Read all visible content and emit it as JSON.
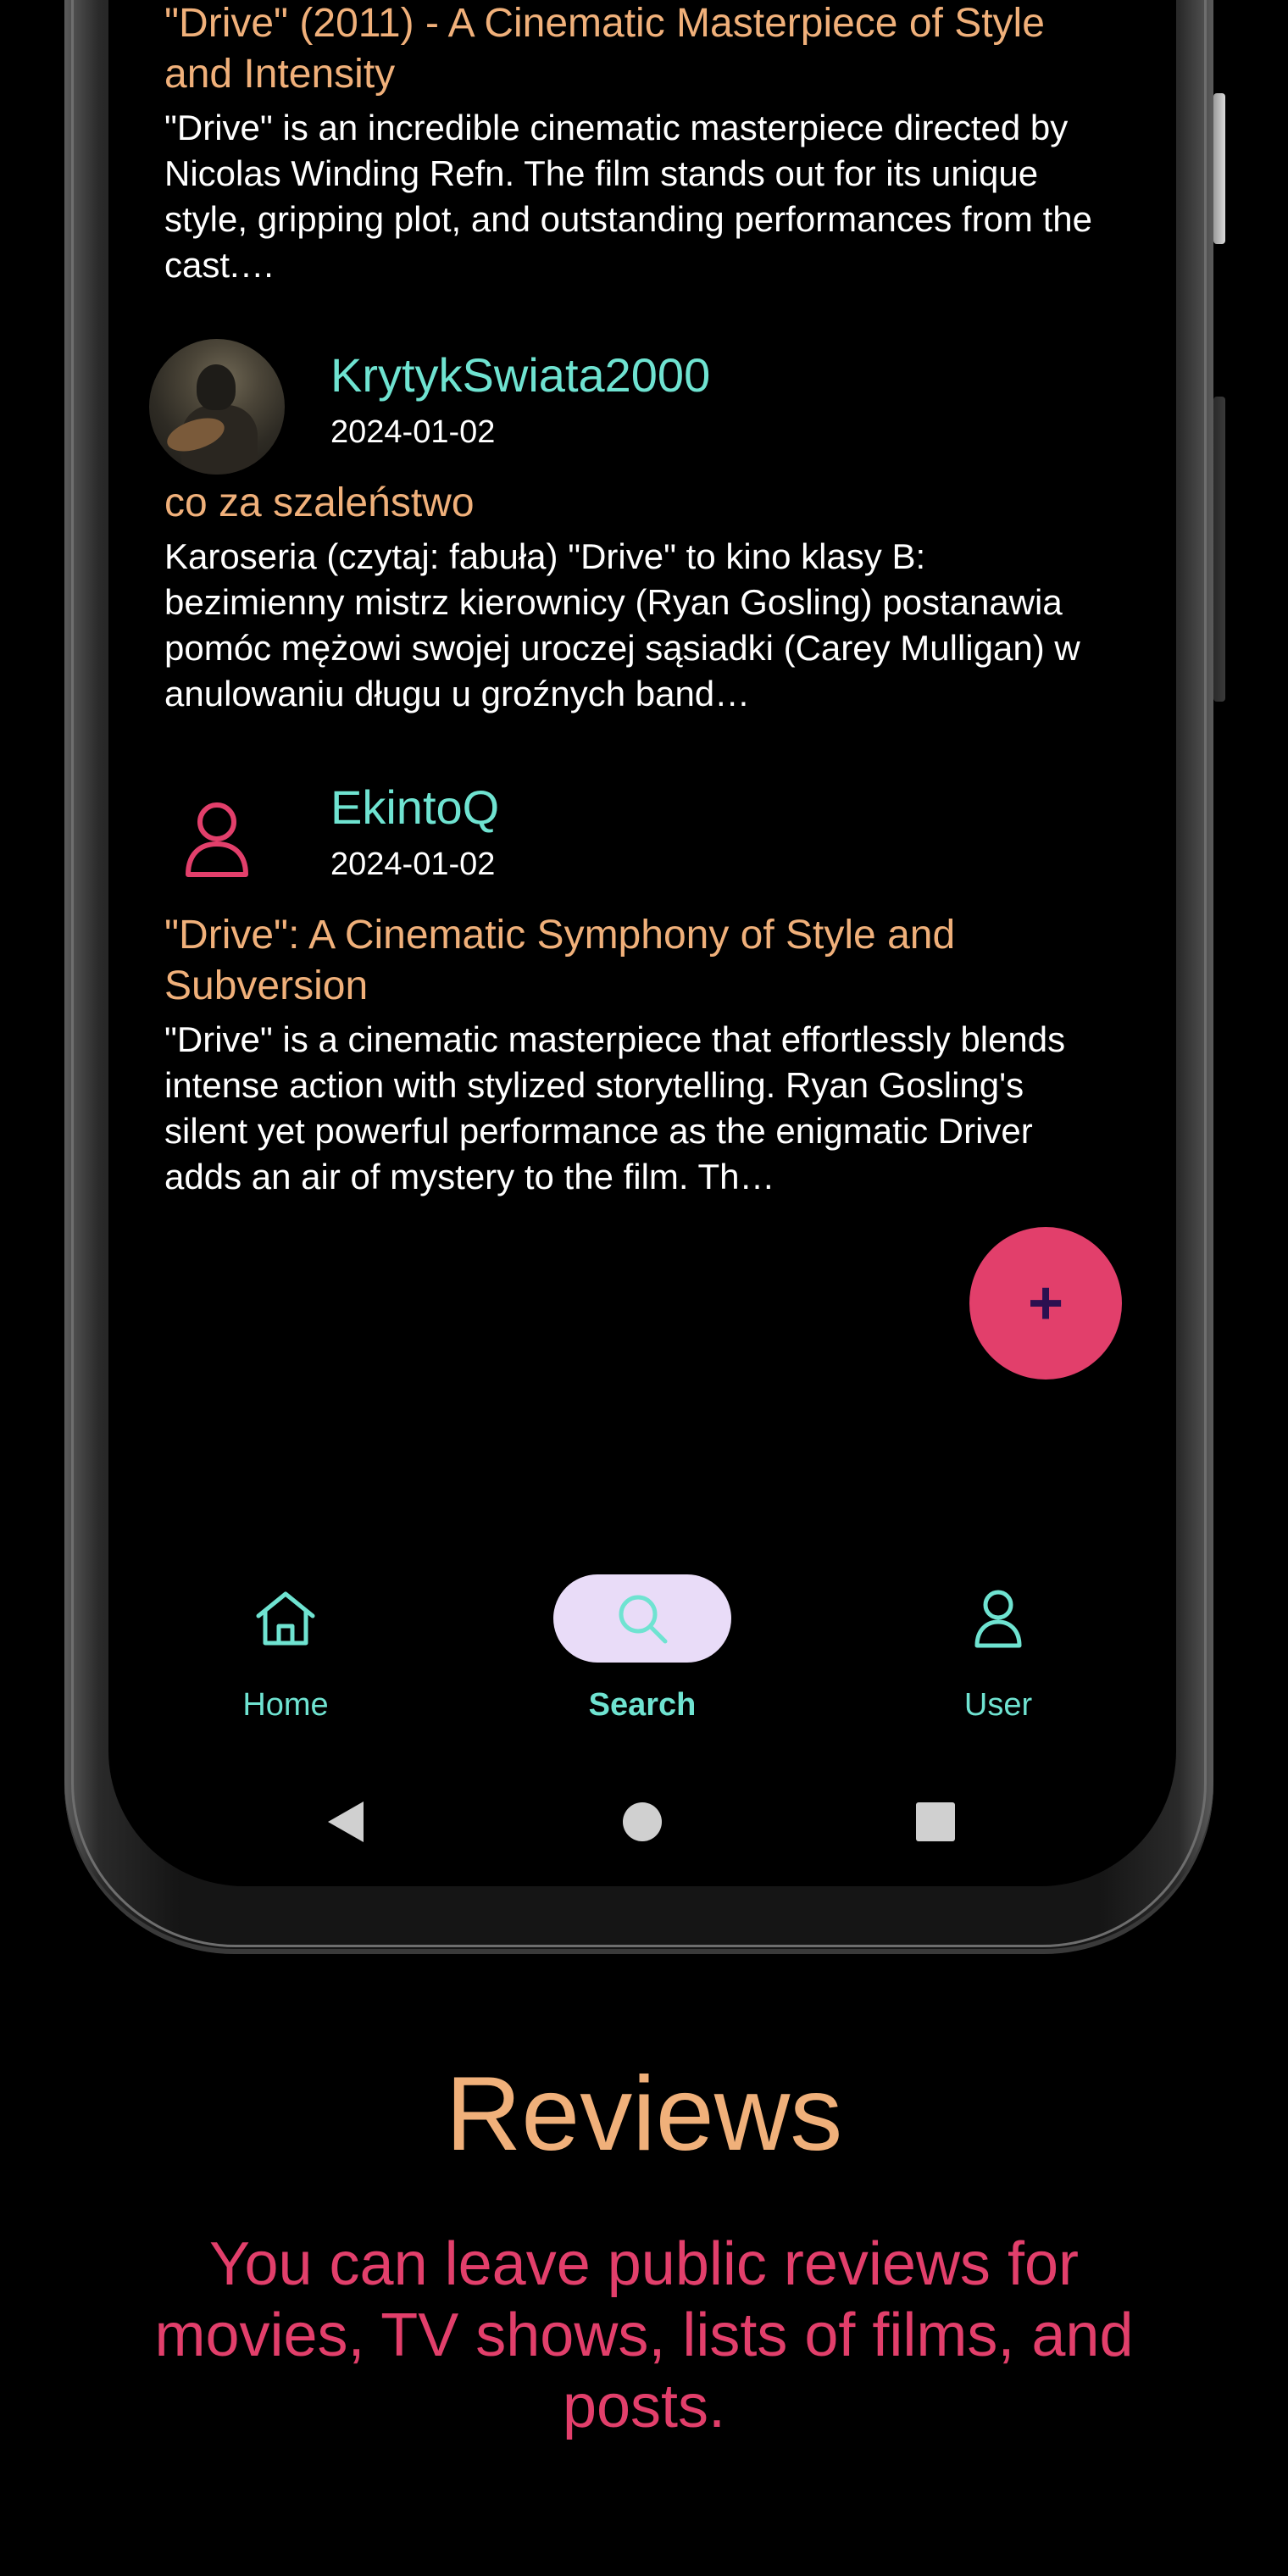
{
  "reviews": [
    {
      "title": "\"Drive\" (2011) - A Cinematic Masterpiece of Style and Intensity",
      "body": "\"Drive\" is an incredible cinematic masterpiece directed by Nicolas Winding Refn. The film stands out for its unique style, gripping plot, and outstanding performances from the cast.…"
    },
    {
      "author": "KrytykSwiata2000",
      "date": "2024-01-02",
      "title": "co za szaleństwo",
      "body": "Karoseria (czytaj: fabuła) \"Drive\" to kino klasy B: bezimienny mistrz kierownicy (Ryan Gosling) postanawia pomóc mężowi swojej uroczej sąsiadki (Carey Mulligan) w anulowaniu długu u groźnych band…"
    },
    {
      "author": "EkintoQ",
      "date": "2024-01-02",
      "title": "\"Drive\": A Cinematic Symphony of Style and Subversion",
      "body": "\"Drive\" is a cinematic masterpiece that effortlessly blends intense action with stylized storytelling. Ryan Gosling's silent yet powerful performance as the enigmatic Driver adds an air of mystery to the film. Th…"
    }
  ],
  "fab": {
    "label": "+",
    "icon": "plus-icon"
  },
  "bottom_nav": [
    {
      "label": "Home",
      "icon": "home-icon",
      "active": false
    },
    {
      "label": "Search",
      "icon": "search-icon",
      "active": true
    },
    {
      "label": "User",
      "icon": "user-icon",
      "active": false
    }
  ],
  "system_nav": [
    "back-icon",
    "home-circle-icon",
    "recents-icon"
  ],
  "promo": {
    "title": "Reviews",
    "subtitle": "You can leave public reviews for movies, TV shows, lists of films, and posts."
  },
  "colors": {
    "background": "#000000",
    "accent_orange": "#f0b07a",
    "accent_teal": "#6fe3d1",
    "accent_pink": "#e23f6b",
    "nav_active_pill": "#e9dcf8"
  }
}
